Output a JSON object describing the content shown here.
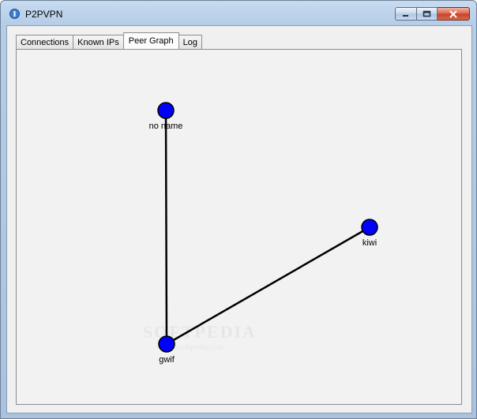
{
  "window": {
    "title": "P2PVPN"
  },
  "tabs": [
    {
      "label": "Connections"
    },
    {
      "label": "Known IPs"
    },
    {
      "label": "Peer Graph",
      "active": true
    },
    {
      "label": "Log"
    }
  ],
  "graph": {
    "nodes": [
      {
        "id": "no-name",
        "label": "no name"
      },
      {
        "id": "kiwi",
        "label": "kiwi"
      },
      {
        "id": "gwif",
        "label": "gwif"
      }
    ],
    "edges": [
      {
        "from": "gwif",
        "to": "no-name"
      },
      {
        "from": "gwif",
        "to": "kiwi"
      }
    ],
    "node_color": "#0000ff",
    "edge_color": "#000000"
  },
  "watermark": {
    "brand": "SOFTPEDIA",
    "url": "www.softpedia.com"
  }
}
